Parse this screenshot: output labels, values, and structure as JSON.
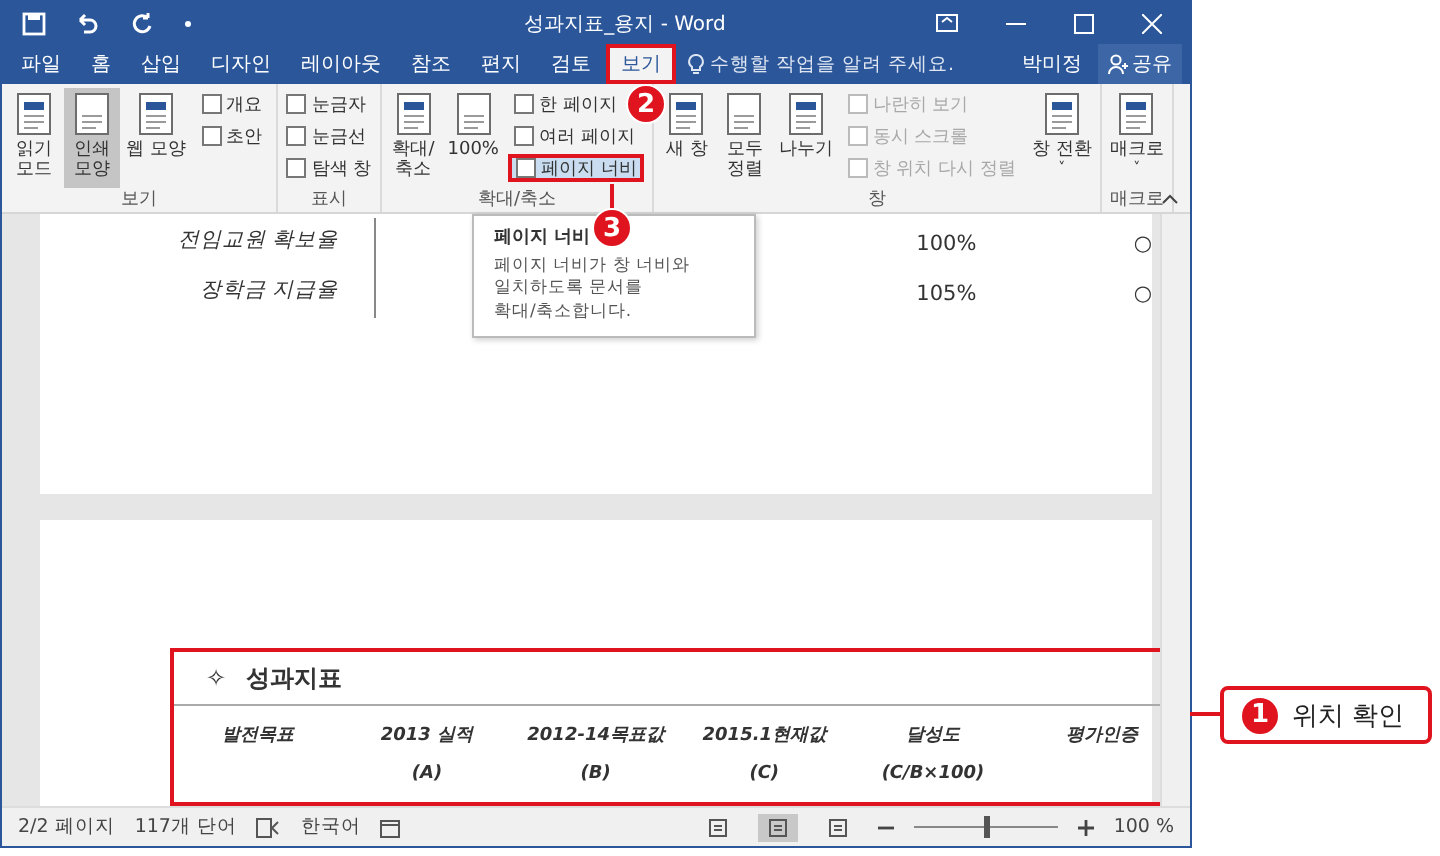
{
  "window": {
    "title": "성과지표_용지 - Word"
  },
  "tabs": [
    {
      "label": "파일",
      "selected": false,
      "outlined": false
    },
    {
      "label": "홈",
      "selected": false,
      "outlined": false
    },
    {
      "label": "삽입",
      "selected": false,
      "outlined": false
    },
    {
      "label": "디자인",
      "selected": false,
      "outlined": false
    },
    {
      "label": "레이아웃",
      "selected": false,
      "outlined": false
    },
    {
      "label": "참조",
      "selected": false,
      "outlined": false
    },
    {
      "label": "편지",
      "selected": false,
      "outlined": false
    },
    {
      "label": "검토",
      "selected": false,
      "outlined": false
    },
    {
      "label": "보기",
      "selected": true,
      "outlined": true
    }
  ],
  "tell_me": {
    "placeholder": "수행할 작업을 알려 주세요."
  },
  "account": {
    "user": "박미정",
    "share": "공유"
  },
  "ribbon": [
    {
      "label": "보기",
      "items": [
        {
          "kind": "large",
          "label": "읽기\n모드",
          "selected": false,
          "dropdown": false
        },
        {
          "kind": "large",
          "label": "인쇄\n모양",
          "selected": true,
          "dropdown": false
        },
        {
          "kind": "large",
          "label": "웹 모양",
          "selected": false,
          "dropdown": false
        },
        {
          "kind": "stack",
          "items": [
            {
              "kind": "small",
              "label": "개요",
              "disabled": false,
              "outlined": false
            },
            {
              "kind": "small",
              "label": "초안",
              "disabled": false,
              "outlined": false
            }
          ]
        }
      ]
    },
    {
      "label": "표시",
      "items": [
        {
          "kind": "stack",
          "items": [
            {
              "kind": "check",
              "label": "눈금자",
              "checked": false
            },
            {
              "kind": "check",
              "label": "눈금선",
              "checked": false
            },
            {
              "kind": "check",
              "label": "탐색 창",
              "checked": false
            }
          ]
        }
      ]
    },
    {
      "label": "확대/축소",
      "items": [
        {
          "kind": "large",
          "label": "확대/\n축소",
          "selected": false,
          "dropdown": false
        },
        {
          "kind": "large",
          "label": "100%",
          "selected": false,
          "dropdown": false
        },
        {
          "kind": "stack",
          "items": [
            {
              "kind": "small",
              "label": "한 페이지",
              "disabled": false,
              "outlined": false
            },
            {
              "kind": "small",
              "label": "여러 페이지",
              "disabled": false,
              "outlined": false
            },
            {
              "kind": "small",
              "label": "페이지 너비",
              "disabled": false,
              "outlined": true
            }
          ]
        }
      ]
    },
    {
      "label": "창",
      "items": [
        {
          "kind": "large",
          "label": "새 창",
          "selected": false,
          "dropdown": false
        },
        {
          "kind": "large",
          "label": "모두\n정렬",
          "selected": false,
          "dropdown": false
        },
        {
          "kind": "large",
          "label": "나누기",
          "selected": false,
          "dropdown": false
        },
        {
          "kind": "stack",
          "items": [
            {
              "kind": "small",
              "label": "나란히 보기",
              "disabled": true,
              "outlined": false
            },
            {
              "kind": "small",
              "label": "동시 스크롤",
              "disabled": true,
              "outlined": false
            },
            {
              "kind": "small",
              "label": "창 위치 다시 정렬",
              "disabled": true,
              "outlined": false
            }
          ]
        },
        {
          "kind": "large",
          "label": "창 전환",
          "selected": false,
          "dropdown": "˅"
        }
      ]
    },
    {
      "label": "매크로",
      "items": [
        {
          "kind": "large",
          "label": "매크로",
          "selected": false,
          "dropdown": "˅"
        }
      ]
    }
  ],
  "tooltip": {
    "title": "페이지 너비",
    "text": "페이지 너비가 창 너비와\n일치하도록 문서를\n확대/축소합니다."
  },
  "page1_rows": [
    {
      "label": "전임교원 확보율",
      "value": "100%",
      "mark": "○"
    },
    {
      "label": "장학금 지급율",
      "value": "105%",
      "mark": "○"
    }
  ],
  "page2": {
    "bullet": "✧",
    "heading": "성과지표",
    "outlined": true,
    "headers": [
      {
        "line1": "발전목표"
      },
      {
        "line1": "2013 실적",
        "line2": "(A)"
      },
      {
        "line1": "2012-14목표값",
        "line2": "(B)"
      },
      {
        "line1": "2015.1현재값",
        "line2": "(C)"
      },
      {
        "line1": "달성도",
        "line2": "(C/B×100)"
      },
      {
        "line1": "평가인증"
      }
    ]
  },
  "status_bar": {
    "page": "2/2 페이지",
    "words": "117개 단어",
    "language": "한국어",
    "views": [
      {
        "selected": false
      },
      {
        "selected": true
      },
      {
        "selected": false
      }
    ],
    "zoom_slider": {
      "level": 0.5
    },
    "zoom": "100 %"
  },
  "annotations": {
    "markers": [
      "1",
      "2",
      "3"
    ],
    "callout": "위치 확인"
  }
}
